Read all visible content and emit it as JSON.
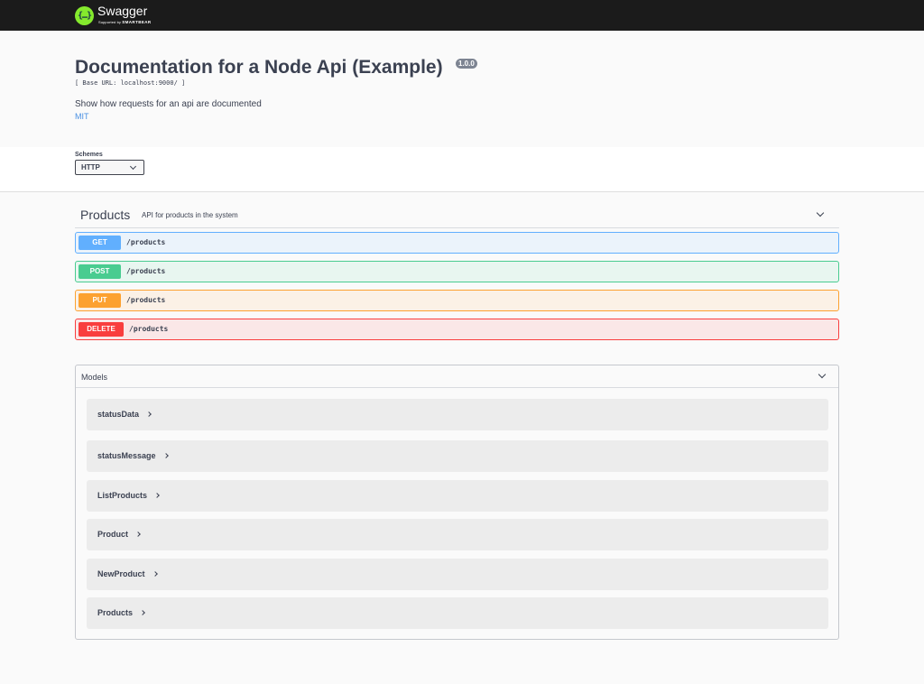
{
  "topbar": {
    "brand": "Swagger",
    "supported_by": "Supported by",
    "company": "SMARTBEAR",
    "logo_glyph": "{…}"
  },
  "info": {
    "title": "Documentation for a Node Api (Example)",
    "version": "1.0.0",
    "base_url": "[ Base URL: localhost:9000/ ]",
    "description": "Show how requests for an api are documented",
    "license": "MIT"
  },
  "schemes": {
    "label": "Schemes",
    "selected": "HTTP"
  },
  "tag": {
    "name": "Products",
    "description": "API for products in the system"
  },
  "operations": [
    {
      "method": "GET",
      "path": "/products",
      "color": "#61affe"
    },
    {
      "method": "POST",
      "path": "/products",
      "color": "#49cc90"
    },
    {
      "method": "PUT",
      "path": "/products",
      "color": "#fca130"
    },
    {
      "method": "DELETE",
      "path": "/products",
      "color": "#f93e3e"
    }
  ],
  "models": {
    "title": "Models",
    "items": [
      "statusData",
      "statusMessage",
      "ListProducts",
      "Product",
      "NewProduct",
      "Products"
    ]
  }
}
